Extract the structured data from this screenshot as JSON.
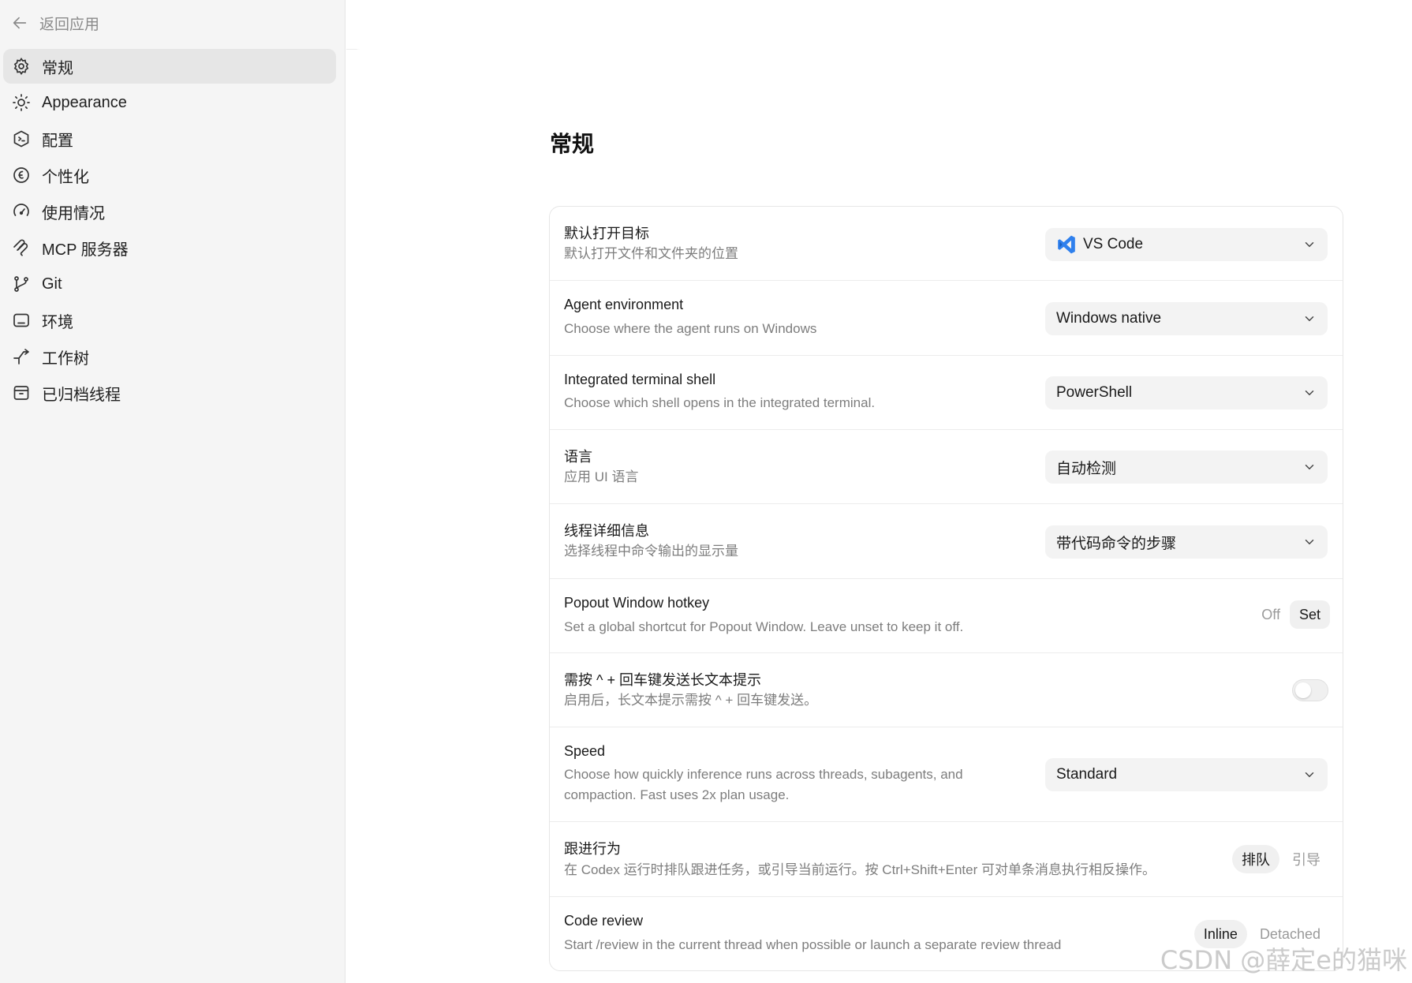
{
  "sidebar": {
    "back_label": "返回应用",
    "items": [
      {
        "label": "常规",
        "icon": "gear-icon"
      },
      {
        "label": "Appearance",
        "icon": "sun-icon"
      },
      {
        "label": "配置",
        "icon": "config-icon"
      },
      {
        "label": "个性化",
        "icon": "personalize-icon"
      },
      {
        "label": "使用情况",
        "icon": "gauge-icon"
      },
      {
        "label": "MCP 服务器",
        "icon": "mcp-icon"
      },
      {
        "label": "Git",
        "icon": "git-branch-icon"
      },
      {
        "label": "环境",
        "icon": "terminal-icon"
      },
      {
        "label": "工作树",
        "icon": "worktree-icon"
      },
      {
        "label": "已归档线程",
        "icon": "archive-icon"
      }
    ]
  },
  "main": {
    "title": "常规",
    "settings": {
      "default_open": {
        "title": "默认打开目标",
        "desc": "默认打开文件和文件夹的位置",
        "value": "VS Code"
      },
      "agent_env": {
        "title": "Agent environment",
        "desc": "Choose where the agent runs on Windows",
        "value": "Windows native"
      },
      "terminal_shell": {
        "title": "Integrated terminal shell",
        "desc": "Choose which shell opens in the integrated terminal.",
        "value": "PowerShell"
      },
      "language": {
        "title": "语言",
        "desc": "应用 UI 语言",
        "value": "自动检测"
      },
      "thread_detail": {
        "title": "线程详细信息",
        "desc": "选择线程中命令输出的显示量",
        "value": "带代码命令的步骤"
      },
      "popout_hotkey": {
        "title": "Popout Window hotkey",
        "desc": "Set a global shortcut for Popout Window. Leave unset to keep it off.",
        "status": "Off",
        "button": "Set"
      },
      "ctrl_enter": {
        "title": "需按 ^ + 回车键发送长文本提示",
        "desc": "启用后，长文本提示需按 ^ + 回车键发送。",
        "enabled": false
      },
      "speed": {
        "title": "Speed",
        "desc_line1": "Choose how quickly inference runs across threads, subagents, and",
        "desc_line2": "compaction. Fast uses 2x plan usage.",
        "value": "Standard"
      },
      "follow_up": {
        "title": "跟进行为",
        "desc": "在 Codex 运行时排队跟进任务，或引导当前运行。按 Ctrl+Shift+Enter 可对单条消息执行相反操作。",
        "options": [
          "排队",
          "引导"
        ],
        "selected": "排队"
      },
      "code_review": {
        "title": "Code review",
        "desc": "Start /review in the current thread when possible or launch a separate review thread",
        "options": [
          "Inline",
          "Detached"
        ],
        "selected": "Inline"
      }
    }
  },
  "watermark": "CSDN @薛定e的猫咪",
  "colors": {
    "vscode_blue": "#2f80ed",
    "sidebar_bg": "#f5f5f5",
    "active_bg": "#e6e6e6"
  }
}
